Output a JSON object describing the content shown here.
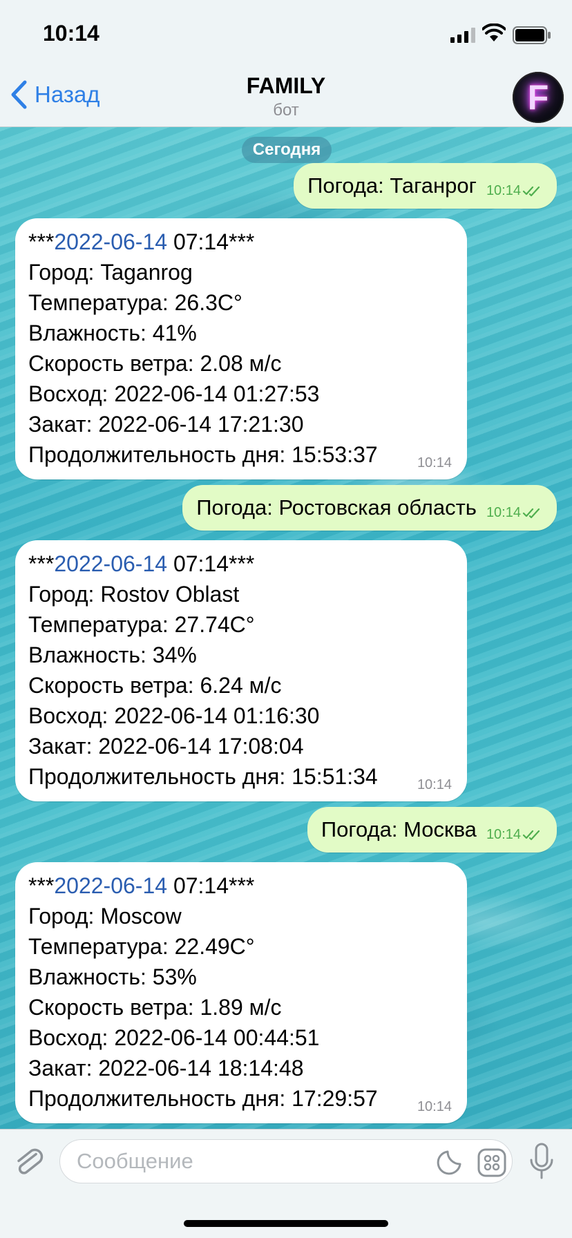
{
  "status": {
    "time": "10:14"
  },
  "header": {
    "back_label": "Назад",
    "title": "FAMILY",
    "subtitle": "бот",
    "avatar_letter": "F"
  },
  "date_separator": "Сегодня",
  "messages": [
    {
      "type": "out",
      "text": "Погода: Таганрог",
      "time": "10:14"
    },
    {
      "type": "in",
      "time": "10:14",
      "date_prefix": "***",
      "date": "2022-06-14",
      "date_suffix": " 07:14***",
      "lines": [
        "Город: Taganrog",
        "Температура: 26.3С°",
        "Влажность: 41%",
        "Скорость ветра: 2.08 м/с",
        "Восход: 2022-06-14 01:27:53",
        "Закат: 2022-06-14 17:21:30",
        "Продолжительность дня: 15:53:37"
      ]
    },
    {
      "type": "out",
      "text": "Погода: Ростовская область",
      "time": "10:14"
    },
    {
      "type": "in",
      "time": "10:14",
      "date_prefix": "***",
      "date": "2022-06-14",
      "date_suffix": " 07:14***",
      "lines": [
        "Город: Rostov Oblast",
        "Температура: 27.74С°",
        "Влажность: 34%",
        "Скорость ветра: 6.24 м/с",
        "Восход: 2022-06-14 01:16:30",
        "Закат: 2022-06-14 17:08:04",
        "Продолжительность дня: 15:51:34"
      ]
    },
    {
      "type": "out",
      "text": "Погода: Москва",
      "time": "10:14"
    },
    {
      "type": "in",
      "time": "10:14",
      "date_prefix": "***",
      "date": "2022-06-14",
      "date_suffix": " 07:14***",
      "lines": [
        "Город: Moscow",
        "Температура: 22.49С°",
        "Влажность: 53%",
        "Скорость ветра: 1.89 м/с",
        "Восход: 2022-06-14 00:44:51",
        "Закат: 2022-06-14 18:14:48",
        "Продолжительность дня: 17:29:57"
      ]
    }
  ],
  "input": {
    "placeholder": "Сообщение"
  },
  "colors": {
    "accent": "#2f80e6",
    "outgoing_bubble": "#e2fbc6",
    "link_date": "#2a5db0",
    "read_check": "#4fae4e"
  }
}
